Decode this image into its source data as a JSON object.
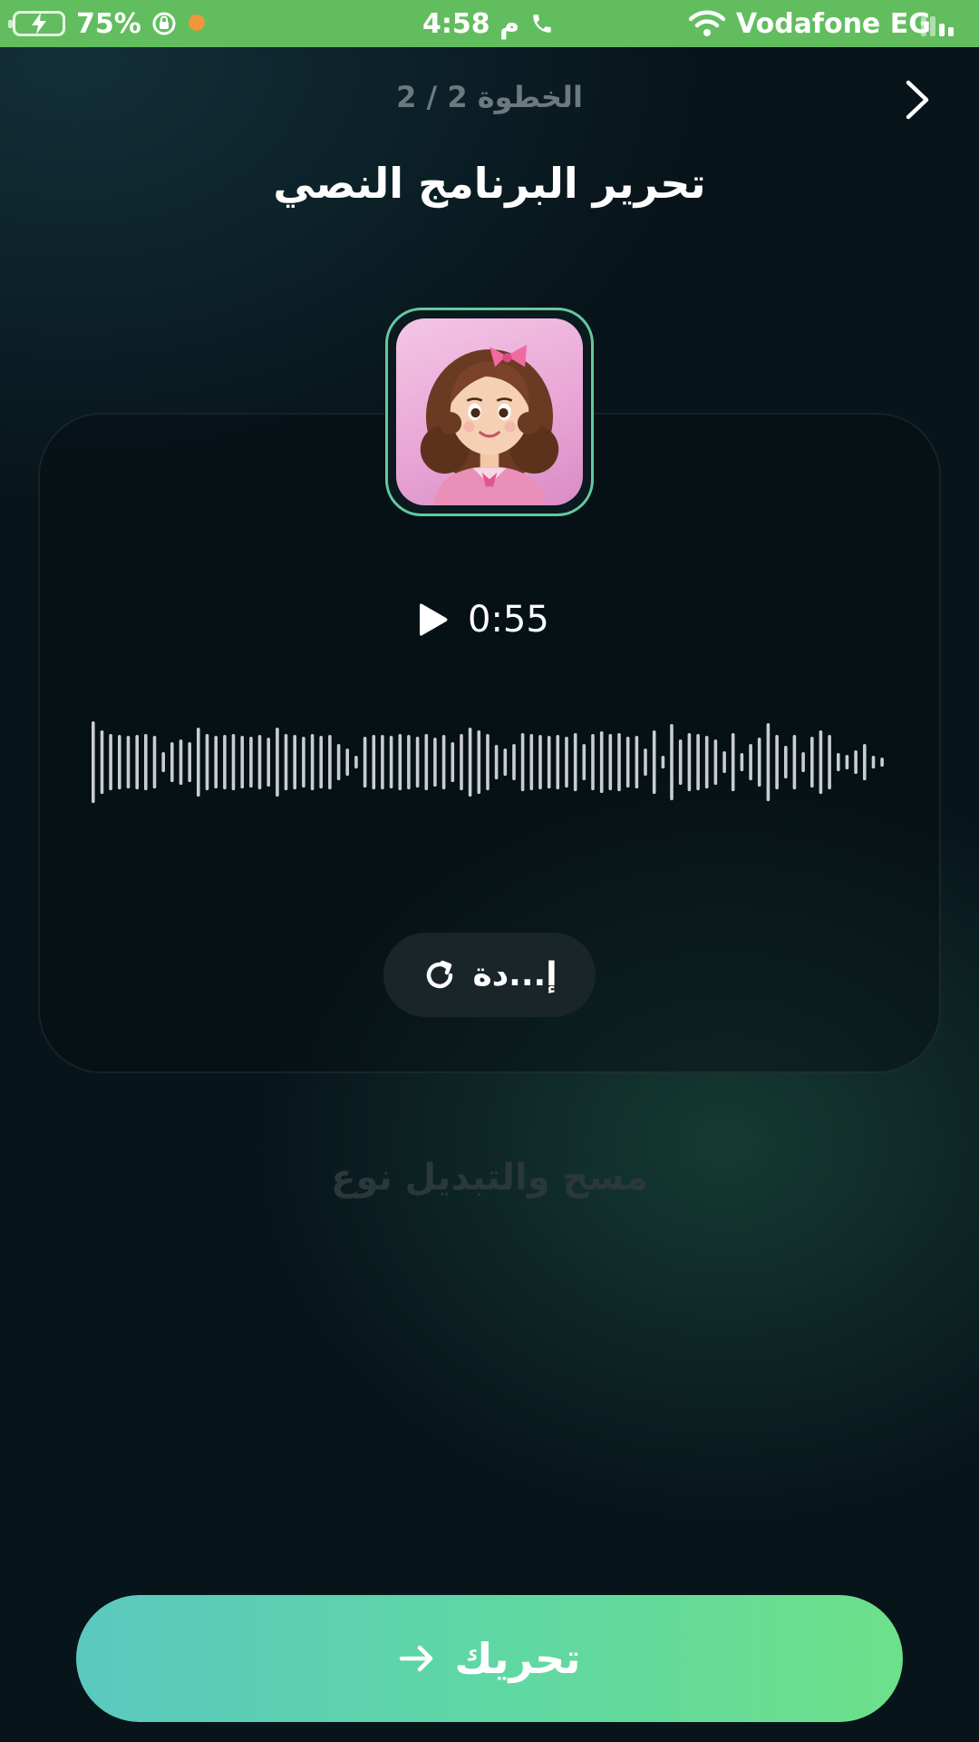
{
  "status_bar": {
    "battery_percent": "75%",
    "time": "4:58 م",
    "carrier": "Vodafone EG",
    "background_color": "#62bd5f",
    "icons": [
      "battery-charging-icon",
      "rotation-lock-icon",
      "orange-dot",
      "phone-icon",
      "wifi-icon",
      "signal-icon"
    ]
  },
  "header": {
    "step": "الخطوة 2 / 2",
    "title": "تحرير البرنامج النصي",
    "back_icon": "chevron-right-icon"
  },
  "player": {
    "play_icon": "play-icon",
    "duration": "0:55",
    "waveform_color": "#c9cdcf"
  },
  "retry_button": {
    "label": "إ...دة",
    "icon": "refresh-icon"
  },
  "secondary_text": "مسح والتبديل نوع",
  "primary_button": {
    "label": "تحريك",
    "icon": "arrow-right-icon"
  },
  "colors": {
    "accent_border": "#64c9a0",
    "button_gradient_start": "#5bc8c0",
    "button_gradient_end": "#6de08a",
    "background": "#07141a"
  }
}
